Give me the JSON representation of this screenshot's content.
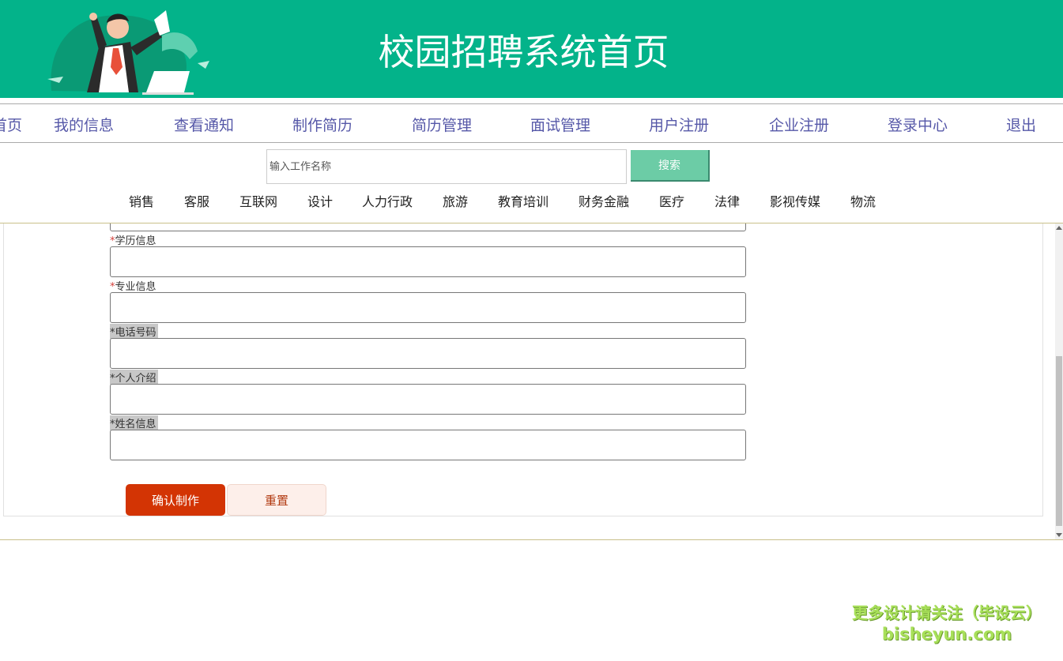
{
  "header": {
    "title": "校园招聘系统首页"
  },
  "nav": {
    "items": [
      "首页",
      "我的信息",
      "查看通知",
      "制作简历",
      "简历管理",
      "面试管理",
      "用户注册",
      "企业注册",
      "登录中心",
      "退出"
    ]
  },
  "search": {
    "placeholder": "输入工作名称",
    "button_label": "搜索"
  },
  "categories": [
    "销售",
    "客服",
    "互联网",
    "设计",
    "人力行政",
    "旅游",
    "教育培训",
    "财务金融",
    "医疗",
    "法律",
    "影视传媒",
    "物流"
  ],
  "form": {
    "fields": [
      {
        "star": "*",
        "label": "学历信息",
        "value": ""
      },
      {
        "star": "*",
        "label": "专业信息",
        "value": ""
      },
      {
        "star": "*",
        "label": "电话号码",
        "value": ""
      },
      {
        "star": "*",
        "label": "个人介绍",
        "value": ""
      },
      {
        "star": "*",
        "label": "姓名信息",
        "value": ""
      }
    ],
    "confirm_label": "确认制作",
    "reset_label": "重置"
  },
  "watermark": {
    "line1": "更多设计请关注（毕设云）",
    "line2": "bisheyun.com"
  },
  "colors": {
    "brand_green": "#03b38a",
    "search_button": "#6ccca6",
    "confirm_button": "#d33404",
    "nav_text": "#5658a8"
  }
}
